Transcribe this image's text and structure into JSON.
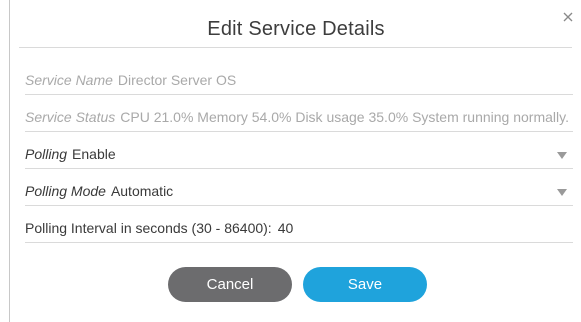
{
  "dialog": {
    "title": "Edit Service Details",
    "close_icon": "close-icon"
  },
  "fields": {
    "service_name": {
      "label": "Service Name",
      "value": "Director Server OS"
    },
    "service_status": {
      "label": "Service Status",
      "value": "CPU 21.0% Memory 54.0% Disk usage 35.0% System running normally."
    },
    "polling": {
      "label": "Polling",
      "value": "Enable"
    },
    "polling_mode": {
      "label": "Polling Mode",
      "value": "Automatic"
    },
    "polling_interval": {
      "label": "Polling Interval in seconds (30 - 86400):",
      "value": "40"
    }
  },
  "buttons": {
    "cancel": "Cancel",
    "save": "Save"
  },
  "colors": {
    "save_button": "#1fa3dc",
    "cancel_button": "#6c6c6e"
  }
}
